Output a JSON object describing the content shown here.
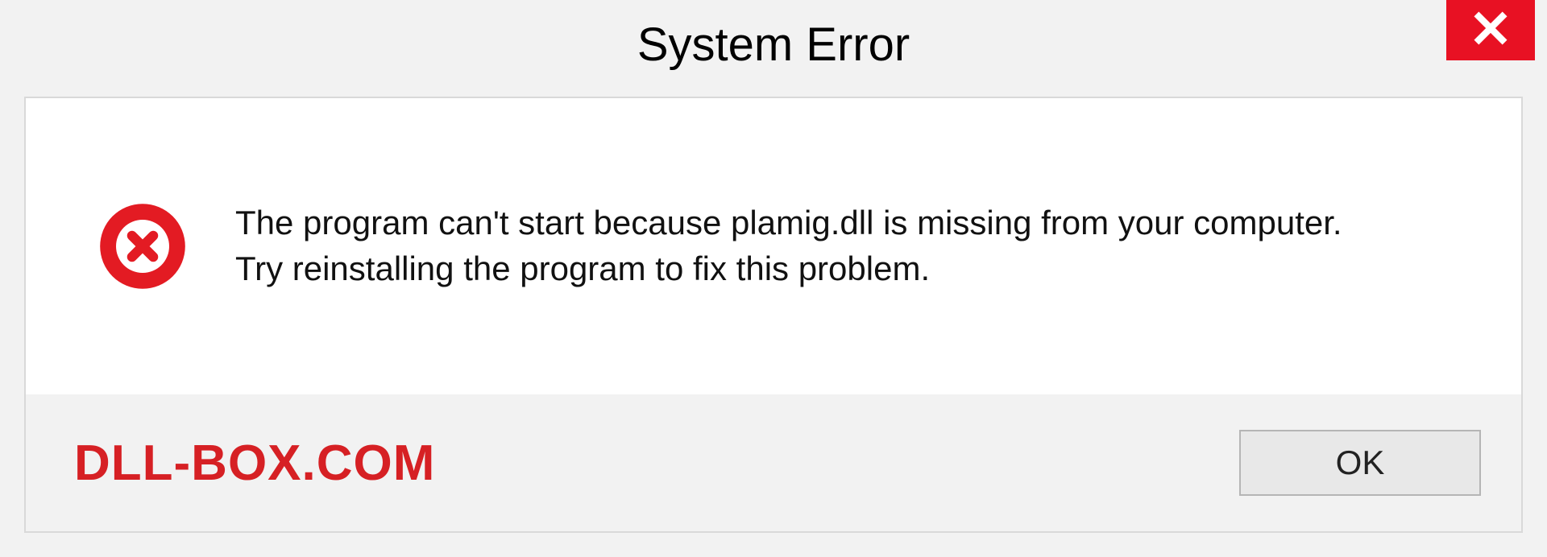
{
  "titlebar": {
    "title": "System Error"
  },
  "message": {
    "line1": "The program can't start because plamig.dll is missing from your computer.",
    "line2": "Try reinstalling the program to fix this problem."
  },
  "footer": {
    "watermark": "DLL-BOX.COM",
    "ok_label": "OK"
  },
  "colors": {
    "close_bg": "#e81123",
    "error_red": "#d62024",
    "watermark_red": "#d62024"
  }
}
